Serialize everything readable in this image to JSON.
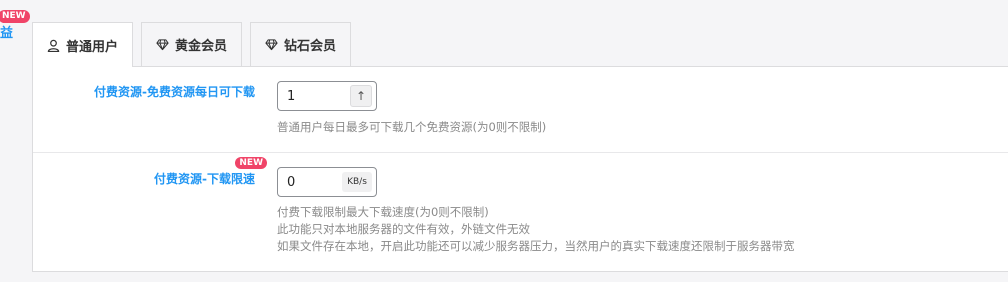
{
  "left": {
    "badge": "NEW",
    "char": "益"
  },
  "tabs": [
    {
      "label": "普通用户",
      "icon": "user-icon",
      "active": true
    },
    {
      "label": "黄金会员",
      "icon": "diamond-icon",
      "active": false
    },
    {
      "label": "钻石会员",
      "icon": "diamond-icon",
      "active": false
    }
  ],
  "settings": {
    "free_limit": {
      "label": "付费资源-免费资源每日可下载",
      "value": "1",
      "spinner_icon": "arrow-up-icon",
      "spinner_glyph": "↑",
      "description": "普通用户每日最多可下载几个免费资源(为0则不限制)"
    },
    "speed_limit": {
      "label": "付费资源-下载限速",
      "badge": "NEW",
      "value": "0",
      "unit": "KB/s",
      "description": [
        "付费下载限制最大下载速度(为0则不限制)",
        "此功能只对本地服务器的文件有效，外链文件无效",
        "如果文件存在本地，开启此功能还可以减少服务器压力，当然用户的真实下载速度还限制于服务器带宽"
      ]
    }
  },
  "colors": {
    "accent": "#2196f3",
    "badge": "#f04468"
  }
}
